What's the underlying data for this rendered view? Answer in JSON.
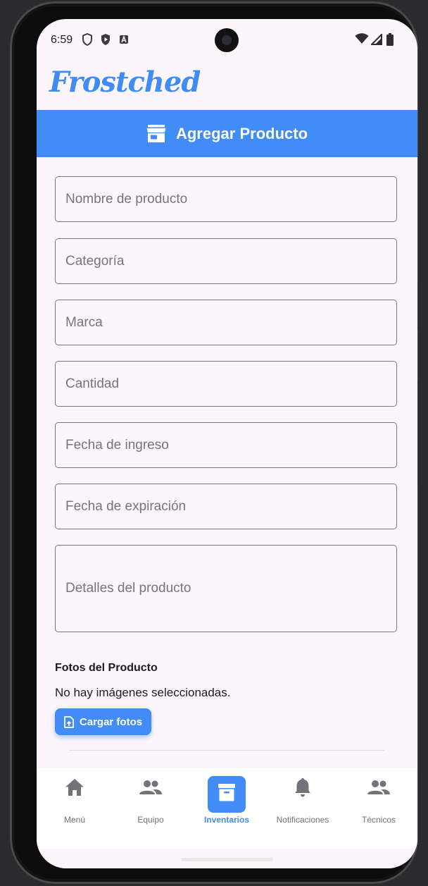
{
  "status_bar": {
    "time": "6:59",
    "left_icons": [
      "shield-icon",
      "play-protect-icon",
      "a-box-icon"
    ],
    "right_icons": [
      "wifi-icon",
      "signal-icon",
      "battery-icon"
    ]
  },
  "app": {
    "logo": "Frostched"
  },
  "header": {
    "icon": "store-icon",
    "title": "Agregar Producto",
    "color": "#418cf7"
  },
  "form": {
    "fields": [
      {
        "placeholder": "Nombre de producto",
        "value": ""
      },
      {
        "placeholder": "Categoría",
        "value": ""
      },
      {
        "placeholder": "Marca",
        "value": ""
      },
      {
        "placeholder": "Cantidad",
        "value": ""
      },
      {
        "placeholder": "Fecha de ingreso",
        "value": ""
      },
      {
        "placeholder": "Fecha de expiración",
        "value": ""
      },
      {
        "placeholder": "Detalles del producto",
        "value": ""
      }
    ]
  },
  "photos": {
    "title": "Fotos del Producto",
    "empty_text": "No hay imágenes seleccionadas.",
    "upload_label": "Cargar fotos"
  },
  "bottom_nav": {
    "active_color": "#418cf7",
    "items": [
      {
        "label": "Menú",
        "icon": "home-icon",
        "active": false
      },
      {
        "label": "Equipo",
        "icon": "people-icon",
        "active": false
      },
      {
        "label": "Inventarios",
        "icon": "archive-icon",
        "active": true
      },
      {
        "label": "Notificaciones",
        "icon": "bell-icon",
        "active": false
      },
      {
        "label": "Técnicos",
        "icon": "people-icon",
        "active": false
      }
    ]
  }
}
